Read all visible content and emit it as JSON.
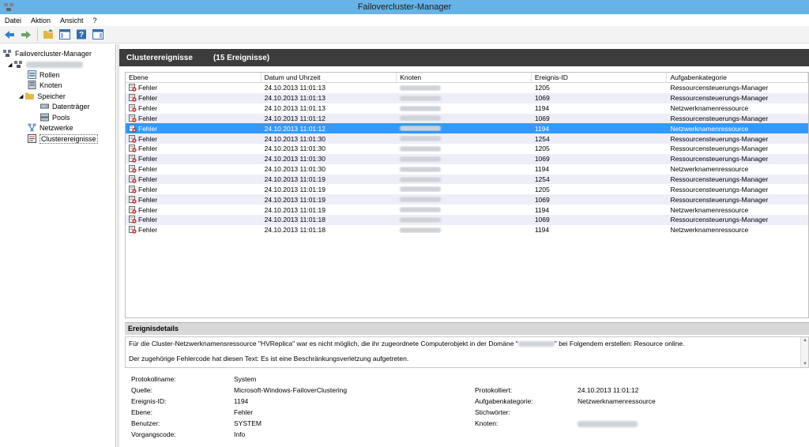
{
  "window": {
    "title": "Failovercluster-Manager"
  },
  "menu": [
    "Datei",
    "Aktion",
    "Ansicht",
    "?"
  ],
  "tree": {
    "root": "Failovercluster-Manager",
    "items": [
      "Rollen",
      "Knoten",
      "Speicher",
      "Datenträger",
      "Pools",
      "Netzwerke",
      "Clusterereignisse"
    ]
  },
  "main": {
    "title": "Clusterereignisse",
    "count": "(15 Ereignisse)"
  },
  "columns": [
    "Ebene",
    "Datum und Uhrzeit",
    "Knoten",
    "Ereignis-ID",
    "Aufgabenkategorie"
  ],
  "events": [
    {
      "level": "Fehler",
      "time": "24.10.2013 11:01:13",
      "id": "1205",
      "category": "Ressourcensteuerungs-Manager"
    },
    {
      "level": "Fehler",
      "time": "24.10.2013 11:01:13",
      "id": "1069",
      "category": "Ressourcensteuerungs-Manager"
    },
    {
      "level": "Fehler",
      "time": "24.10.2013 11:01:13",
      "id": "1194",
      "category": "Netzwerknamenressource"
    },
    {
      "level": "Fehler",
      "time": "24.10.2013 11:01:12",
      "id": "1069",
      "category": "Ressourcensteuerungs-Manager"
    },
    {
      "level": "Fehler",
      "time": "24.10.2013 11:01:12",
      "id": "1194",
      "category": "Netzwerknamenressource"
    },
    {
      "level": "Fehler",
      "time": "24.10.2013 11:01:30",
      "id": "1254",
      "category": "Ressourcensteuerungs-Manager"
    },
    {
      "level": "Fehler",
      "time": "24.10.2013 11:01:30",
      "id": "1205",
      "category": "Ressourcensteuerungs-Manager"
    },
    {
      "level": "Fehler",
      "time": "24.10.2013 11:01:30",
      "id": "1069",
      "category": "Ressourcensteuerungs-Manager"
    },
    {
      "level": "Fehler",
      "time": "24.10.2013 11:01:30",
      "id": "1194",
      "category": "Netzwerknamenressource"
    },
    {
      "level": "Fehler",
      "time": "24.10.2013 11:01:19",
      "id": "1254",
      "category": "Ressourcensteuerungs-Manager"
    },
    {
      "level": "Fehler",
      "time": "24.10.2013 11:01:19",
      "id": "1205",
      "category": "Ressourcensteuerungs-Manager"
    },
    {
      "level": "Fehler",
      "time": "24.10.2013 11:01:19",
      "id": "1069",
      "category": "Ressourcensteuerungs-Manager"
    },
    {
      "level": "Fehler",
      "time": "24.10.2013 11:01:19",
      "id": "1194",
      "category": "Netzwerknamenressource"
    },
    {
      "level": "Fehler",
      "time": "24.10.2013 11:01:18",
      "id": "1069",
      "category": "Ressourcensteuerungs-Manager"
    },
    {
      "level": "Fehler",
      "time": "24.10.2013 11:01:18",
      "id": "1194",
      "category": "Netzwerknamenressource"
    }
  ],
  "details": {
    "title": "Ereignisdetails",
    "message_part1": "Für die Cluster-Netzwerknamensressource \"HVReplica\" war es nicht möglich, die ihr zugeordnete Computerobjekt in der Domäne \"",
    "message_part2": "\" bei Folgendem erstellen: Resource online.",
    "message_line2": "Der zugehörige Fehlercode hat diesen Text: Es ist eine Beschränkungsverletzung aufgetreten.",
    "labels": {
      "protokollname": "Protokollname:",
      "quelle": "Quelle:",
      "ereignis_id": "Ereignis-ID:",
      "ebene": "Ebene:",
      "benutzer": "Benutzer:",
      "vorgangscode": "Vorgangscode:",
      "protokolliert": "Protokolliert:",
      "aufgabenkategorie": "Aufgabenkategorie:",
      "stichwoerter": "Stichwörter:",
      "knoten": "Knoten:"
    },
    "values": {
      "protokollname": "System",
      "quelle": "Microsoft-Windows-FailoverClustering",
      "ereignis_id": "1194",
      "ebene": "Fehler",
      "benutzer": "SYSTEM",
      "vorgangscode": "Info",
      "protokolliert": "24.10.2013 11:01:12",
      "aufgabenkategorie": "Netzwerknamenressource"
    }
  },
  "selected_row": 4,
  "colors": {
    "titlebar": "#67b2e6",
    "header": "#3c3c3c",
    "selection": "#3399ff",
    "alt_row": "#edeef8"
  }
}
